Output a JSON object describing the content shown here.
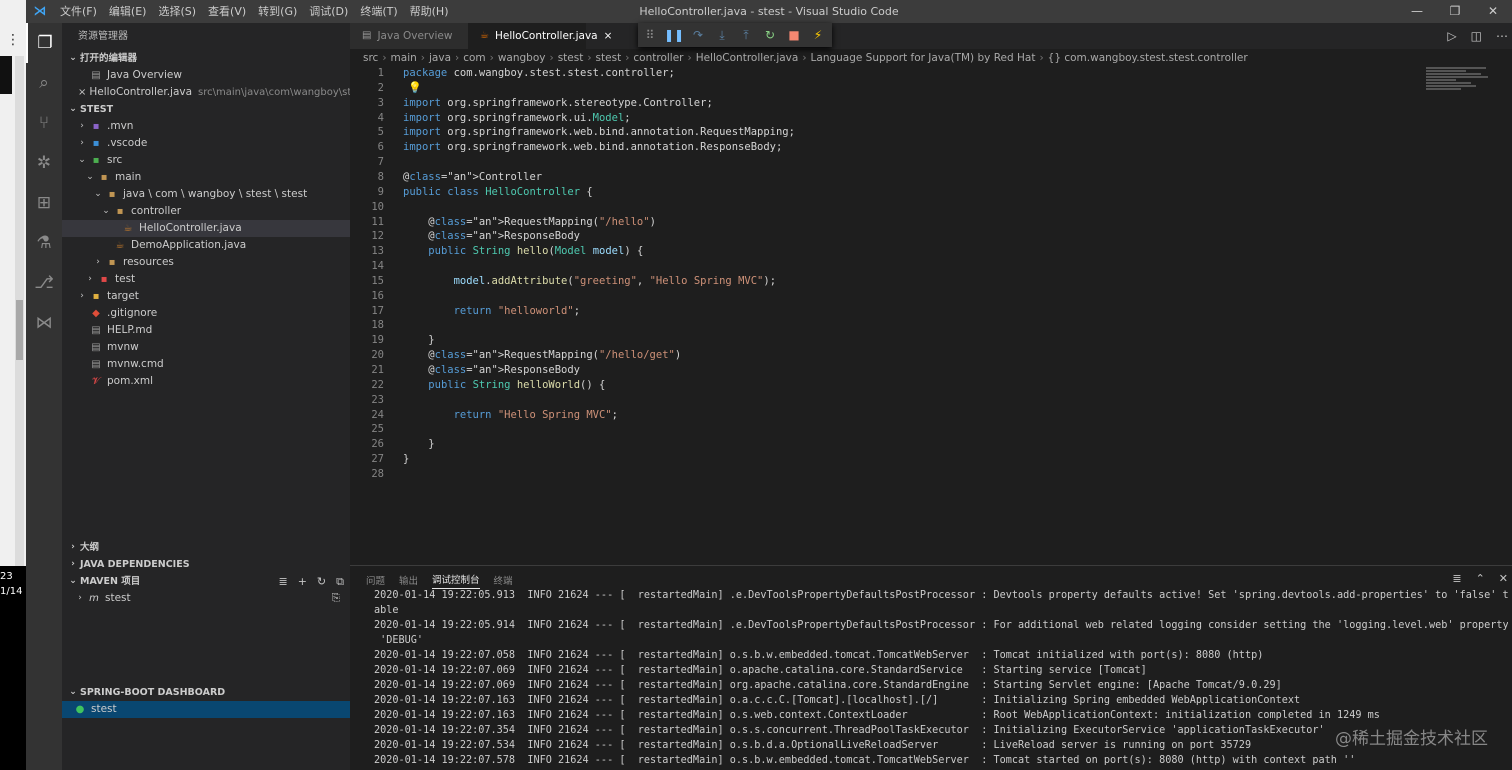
{
  "outer_strip": {
    "dots": "⋮",
    "line1": "23",
    "line2": "1/14"
  },
  "titlebar": {
    "title": "HelloController.java - stest - Visual Studio Code",
    "menu": [
      "文件(F)",
      "编辑(E)",
      "选择(S)",
      "查看(V)",
      "转到(G)",
      "调试(D)",
      "终端(T)",
      "帮助(H)"
    ],
    "controls": {
      "minimize": "—",
      "restore": "❐",
      "close": "✕"
    }
  },
  "activitybar": [
    "explorer-icon",
    "search-icon",
    "source-control-icon",
    "debug-icon",
    "extensions-icon",
    "test-icon",
    "git-icon",
    "remote-icon"
  ],
  "sidebar": {
    "title": "资源管理器",
    "open_editors": {
      "header": "打开的编辑器",
      "items": [
        {
          "label": "Java Overview",
          "sub": ""
        },
        {
          "label": "HelloController.java",
          "sub": "src\\main\\java\\com\\wangboy\\stest\\..."
        }
      ]
    },
    "workspace": {
      "header": "STEST",
      "items": [
        {
          "label": ".mvn",
          "icon": "▪",
          "color": "#8b64c8",
          "indent": 0,
          "chev": "›"
        },
        {
          "label": ".vscode",
          "icon": "▪",
          "color": "#3c8fd6",
          "indent": 0,
          "chev": "›"
        },
        {
          "label": "src",
          "icon": "▪",
          "color": "#4caf50",
          "indent": 0,
          "chev": "⌄"
        },
        {
          "label": "main",
          "icon": "▪",
          "color": "#c09553",
          "indent": 1,
          "chev": "⌄"
        },
        {
          "label": "java \\ com \\ wangboy \\ stest \\ stest",
          "icon": "▪",
          "color": "#c09553",
          "indent": 2,
          "chev": "⌄"
        },
        {
          "label": "controller",
          "icon": "▪",
          "color": "#c09553",
          "indent": 3,
          "chev": "⌄"
        },
        {
          "label": "HelloController.java",
          "icon": "☕",
          "color": "#c07a2c",
          "indent": 4,
          "chev": ""
        },
        {
          "label": "DemoApplication.java",
          "icon": "☕",
          "color": "#c07a2c",
          "indent": 3,
          "chev": ""
        },
        {
          "label": "resources",
          "icon": "▪",
          "color": "#c09553",
          "indent": 2,
          "chev": "›"
        },
        {
          "label": "test",
          "icon": "▪",
          "color": "#e04848",
          "indent": 1,
          "chev": "›"
        },
        {
          "label": "target",
          "icon": "▪",
          "color": "#e0b040",
          "indent": 0,
          "chev": "›"
        },
        {
          "label": ".gitignore",
          "icon": "◆",
          "color": "#e04e39",
          "indent": 0,
          "chev": ""
        },
        {
          "label": "HELP.md",
          "icon": "▤",
          "color": "#9a9a9a",
          "indent": 0,
          "chev": ""
        },
        {
          "label": "mvnw",
          "icon": "▤",
          "color": "#9a9a9a",
          "indent": 0,
          "chev": ""
        },
        {
          "label": "mvnw.cmd",
          "icon": "▤",
          "color": "#9a9a9a",
          "indent": 0,
          "chev": ""
        },
        {
          "label": "pom.xml",
          "icon": "𝓥",
          "color": "#e04848",
          "indent": 0,
          "chev": ""
        }
      ]
    },
    "outline": "大纲",
    "java_deps": "JAVA DEPENDENCIES",
    "maven": {
      "header": "MAVEN 项目",
      "item": "stest"
    },
    "spring": {
      "header": "SPRING-BOOT DASHBOARD",
      "item": "stest"
    }
  },
  "tabs": [
    {
      "label": "Java Overview",
      "active": false
    },
    {
      "label": "HelloController.java",
      "active": true,
      "close": "×"
    }
  ],
  "debug_toolbar": [
    "⠿",
    "❚❚",
    "↷",
    "⤓",
    "⤒",
    "↻",
    "■",
    "⚡"
  ],
  "editor_actions": [
    "▷",
    "◫",
    "⋯"
  ],
  "breadcrumb": [
    "src",
    "main",
    "java",
    "com",
    "wangboy",
    "stest",
    "stest",
    "controller",
    "HelloController.java",
    "Language Support for Java(TM) by Red Hat",
    "{} com.wangboy.stest.stest.controller"
  ],
  "code_lines": [
    "package com.wangboy.stest.stest.controller;",
    "",
    "import org.springframework.stereotype.Controller;",
    "import org.springframework.ui.Model;",
    "import org.springframework.web.bind.annotation.RequestMapping;",
    "import org.springframework.web.bind.annotation.ResponseBody;",
    "",
    "@Controller",
    "public class HelloController {",
    "",
    "    @RequestMapping(\"/hello\")",
    "    @ResponseBody",
    "    public String hello(Model model) {",
    "",
    "        model.addAttribute(\"greeting\", \"Hello Spring MVC\");",
    "",
    "        return \"helloworld\";",
    "",
    "    }",
    "    @RequestMapping(\"/hello/get\")",
    "    @ResponseBody",
    "    public String helloWorld() {",
    "",
    "        return \"Hello Spring MVC\";",
    "",
    "    }",
    "}",
    ""
  ],
  "panel": {
    "tabs": [
      "问题",
      "输出",
      "调试控制台",
      "终端"
    ],
    "active_tab": "调试控制台",
    "tools": [
      "≣",
      "⌃",
      "✕"
    ],
    "console": [
      "2020-01-14 19:22:05.913  INFO 21624 --- [  restartedMain] .e.DevToolsPropertyDefaultsPostProcessor : Devtools property defaults active! Set 'spring.devtools.add-properties' to 'false' to dis",
      "able",
      "2020-01-14 19:22:05.914  INFO 21624 --- [  restartedMain] .e.DevToolsPropertyDefaultsPostProcessor : For additional web related logging consider setting the 'logging.level.web' property to",
      " 'DEBUG'",
      "2020-01-14 19:22:07.058  INFO 21624 --- [  restartedMain] o.s.b.w.embedded.tomcat.TomcatWebServer  : Tomcat initialized with port(s): 8080 (http)",
      "2020-01-14 19:22:07.069  INFO 21624 --- [  restartedMain] o.apache.catalina.core.StandardService   : Starting service [Tomcat]",
      "2020-01-14 19:22:07.069  INFO 21624 --- [  restartedMain] org.apache.catalina.core.StandardEngine  : Starting Servlet engine: [Apache Tomcat/9.0.29]",
      "2020-01-14 19:22:07.163  INFO 21624 --- [  restartedMain] o.a.c.c.C.[Tomcat].[localhost].[/]       : Initializing Spring embedded WebApplicationContext",
      "2020-01-14 19:22:07.163  INFO 21624 --- [  restartedMain] o.s.web.context.ContextLoader            : Root WebApplicationContext: initialization completed in 1249 ms",
      "2020-01-14 19:22:07.354  INFO 21624 --- [  restartedMain] o.s.s.concurrent.ThreadPoolTaskExecutor  : Initializing ExecutorService 'applicationTaskExecutor'",
      "2020-01-14 19:22:07.534  INFO 21624 --- [  restartedMain] o.s.b.d.a.OptionalLiveReloadServer       : LiveReload server is running on port 35729",
      "2020-01-14 19:22:07.578  INFO 21624 --- [  restartedMain] o.s.b.w.embedded.tomcat.TomcatWebServer  : Tomcat started on port(s): 8080 (http) with context path ''"
    ]
  },
  "watermark": "@稀土掘金技术社区"
}
